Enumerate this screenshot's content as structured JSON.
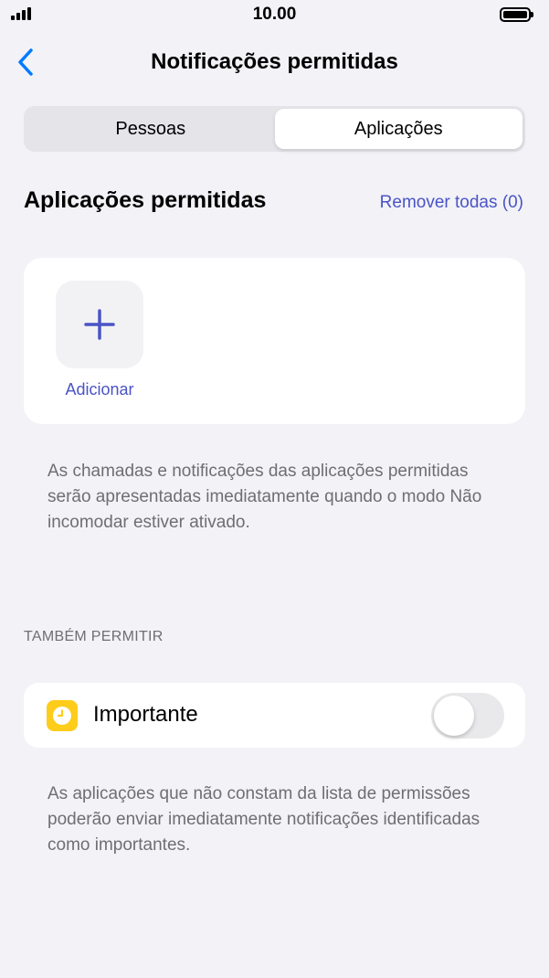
{
  "status_bar": {
    "time": "10.00"
  },
  "nav": {
    "title": "Notificações permitidas",
    "back_icon": "chevron-left-icon"
  },
  "segmented": {
    "items": [
      {
        "label": "Pessoas",
        "selected": false
      },
      {
        "label": "Aplicações",
        "selected": true
      }
    ]
  },
  "section": {
    "title": "Aplicações permitidas",
    "remove_all": "Remover todas (0)"
  },
  "apps_card": {
    "add_label": "Adicionar",
    "add_icon": "plus-icon"
  },
  "footnote_apps": "As chamadas e notificações das aplicações permitidas serão apresentadas imediatamente quando o modo Não incomodar estiver ativado.",
  "also_allow": {
    "header": "TAMBÉM PERMITIR",
    "important_label": "Importante",
    "important_icon": "clock-icon",
    "toggle_on": false
  },
  "footnote_important": "As aplicações que não constam da lista de permissões poderão enviar imediatamente notificações identificadas como importantes.",
  "colors": {
    "accent": "#4a54c6",
    "background": "#f2f2f7",
    "important_icon_bg": "#fecc1a",
    "back_chevron": "#007aff"
  }
}
